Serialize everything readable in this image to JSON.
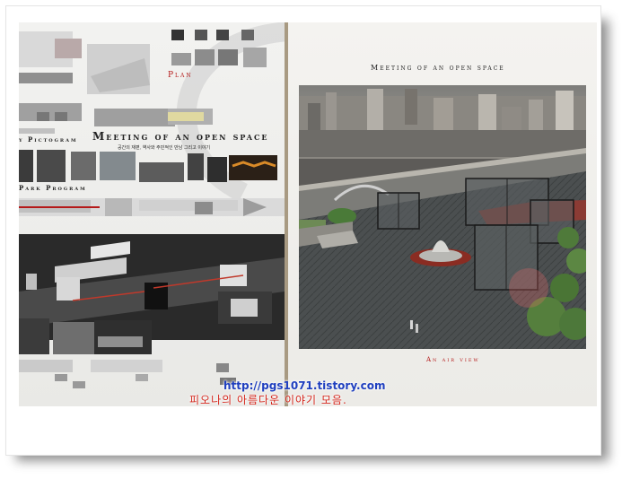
{
  "left_board": {
    "title": "Meeting of an open space",
    "subtitle": "공간의 재편, 역사와 주민적인 만남 그리고 이야기",
    "plan_label": "Plan",
    "pictogram_label": "y Pictogram",
    "park_program_label": "Park Program"
  },
  "right_board": {
    "title": "Meeting of an open space",
    "caption": "An air view"
  },
  "watermark": {
    "url": "http://pgs1071.tistory.com",
    "text": "피오나의 아름다운 이야기 모음."
  },
  "colors": {
    "frame_shadow": "#3a3a3a",
    "wall": "#c9b79c",
    "board": "#efefec",
    "accent_red": "#b51a1a",
    "url_blue": "#1f3fbf",
    "text_red": "#d4261c"
  }
}
